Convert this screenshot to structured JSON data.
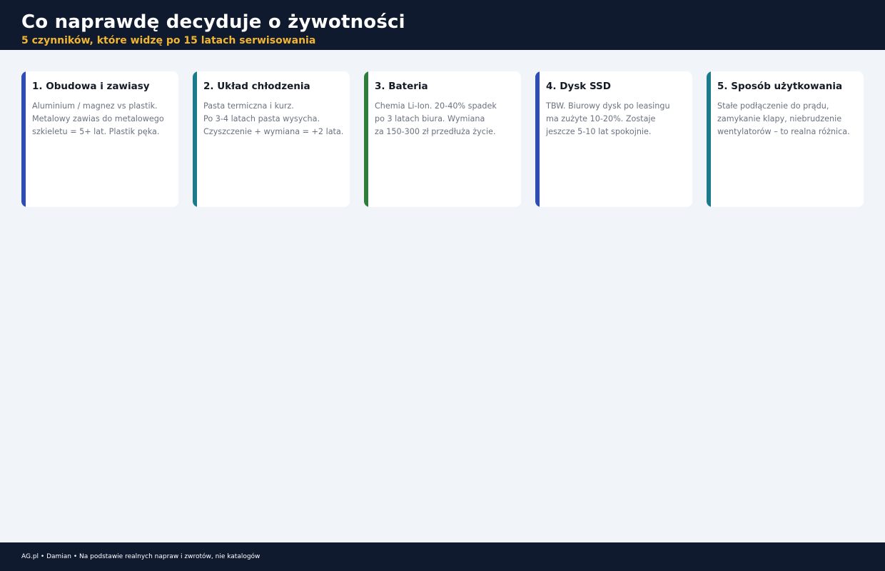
{
  "header": {
    "title": "Co naprawdę decyduje o żywotności",
    "subtitle": "5 czynników, które widzę po 15 latach serwisowania"
  },
  "cards": [
    {
      "title": "1. Obudowa i zawiasy",
      "lines": [
        "Aluminium / magnez vs plastik.",
        "Metalowy zawias do metalowego",
        "szkieletu = 5+ lat. Plastik pęka."
      ],
      "accent": "#2d4db3"
    },
    {
      "title": "2. Układ chłodzenia",
      "lines": [
        "Pasta termiczna i kurz.",
        "Po 3-4 latach pasta wysycha.",
        "Czyszczenie + wymiana = +2 lata."
      ],
      "accent": "#1b7a8c"
    },
    {
      "title": "3. Bateria",
      "lines": [
        "Chemia Li-Ion. 20-40% spadek",
        "po 3 latach biura. Wymiana",
        "za 150-300 zł przedłuża życie."
      ],
      "accent": "#2e7d3a"
    },
    {
      "title": "4. Dysk SSD",
      "lines": [
        "TBW. Biurowy dysk po leasingu",
        "ma zużyte 10-20%. Zostaje",
        "jeszcze 5-10 lat spokojnie."
      ],
      "accent": "#2d4db3"
    },
    {
      "title": "5. Sposób użytkowania",
      "lines": [
        "Stałe podłączenie do prądu,",
        "zamykanie klapy, niebrudzenie",
        "wentylatorów – to realna różnica."
      ],
      "accent": "#1b7a8c"
    }
  ],
  "footer": {
    "text": "AG.pl • Damian • Na podstawie realnych napraw i zwrotów, nie katalogów"
  }
}
